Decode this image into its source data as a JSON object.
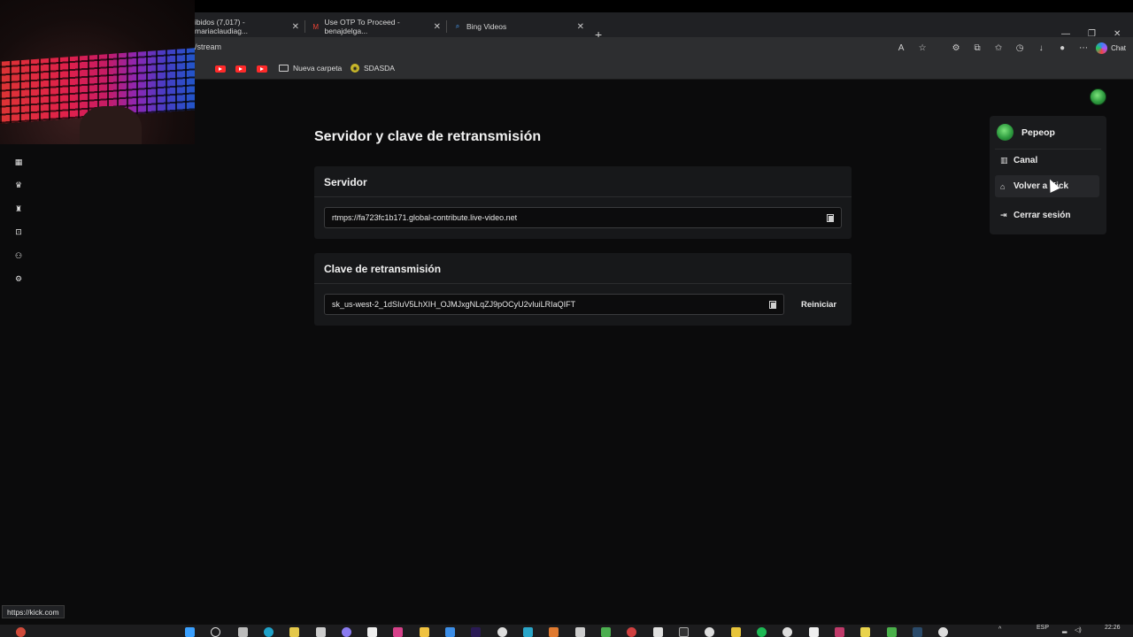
{
  "browser": {
    "tabs": [
      {
        "title": "ibidos (7,017) - mariaclaudiag...",
        "icon": "gmail-icon"
      },
      {
        "title": "Use OTP To Proceed - benajdelga...",
        "icon": "gmail-icon"
      },
      {
        "title": "Bing Videos",
        "icon": "bing-search-icon"
      }
    ],
    "url": "/stream",
    "chat_label": "Chat",
    "bookmarks": {
      "folder_label": "Nueva carpeta",
      "site_label": "SDASDA"
    }
  },
  "kick": {
    "sidebar_icons": [
      "dashboard-icon",
      "trophy-icon",
      "community-icon",
      "capture-icon",
      "users-icon",
      "gear-icon"
    ],
    "page_title": "Servidor y clave de retransmisión",
    "server": {
      "heading": "Servidor",
      "value": "rtmps://fa723fc1b171.global-contribute.live-video.net"
    },
    "stream_key": {
      "heading": "Clave de retransmisión",
      "value": "sk_us-west-2_1dSIuV5LhXIH_OJMJxgNLqZJ9pOCyU2vIuiLRIaQIFT",
      "reset_label": "Reiniciar"
    },
    "user_menu": {
      "username": "Pepeop",
      "items": [
        {
          "label": "Canal",
          "icon": "channel-icon"
        },
        {
          "label": "Volver a Kick",
          "icon": "home-icon"
        },
        {
          "label": "Cerrar sesión",
          "icon": "logout-icon"
        }
      ]
    }
  },
  "status_url": "https://kick.com",
  "taskbar": {
    "language": "ESP",
    "time": "22:26"
  }
}
